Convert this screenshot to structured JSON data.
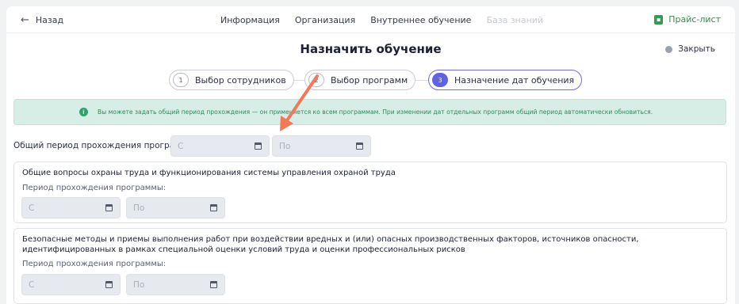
{
  "header": {
    "back_label": "Назад",
    "nav": [
      "Информация",
      "Организация",
      "Внутреннее обучение",
      "База знаний"
    ],
    "price_label": "Прайс-лист"
  },
  "page": {
    "title": "Назначить обучение",
    "close_label": "Закрыть"
  },
  "steps": [
    {
      "num": "1",
      "label": "Выбор сотрудников"
    },
    {
      "num": "2",
      "label": "Выбор программ"
    },
    {
      "num": "3",
      "label": "Назначение дат обучения"
    }
  ],
  "info_text": "Вы можете задать общий период прохождения — он применяется ко всем программам. При изменении дат отдельных программ общий период автоматически обновиться.",
  "general_period": {
    "label": "Общий период прохождения программ:",
    "from_placeholder": "С",
    "to_placeholder": "По"
  },
  "programs": [
    {
      "title": "Общие вопросы охраны труда и функционирования системы управления охраной труда",
      "period_label": "Период прохождения программы:",
      "from_placeholder": "С",
      "to_placeholder": "По"
    },
    {
      "title": "Безопасные методы и приемы выполнения работ при воздействии вредных и (или) опасных производственных факторов, источников опасности, идентифицированных в рамках специальной оценки условий труда и оценки профессиональных рисков",
      "period_label": "Период прохождения программы:",
      "from_placeholder": "С",
      "to_placeholder": "По"
    }
  ],
  "colors": {
    "accent": "#5f63e0",
    "info_bg": "#d6eee5",
    "info_text": "#2e8a5a",
    "arrow": "#f07a56"
  }
}
